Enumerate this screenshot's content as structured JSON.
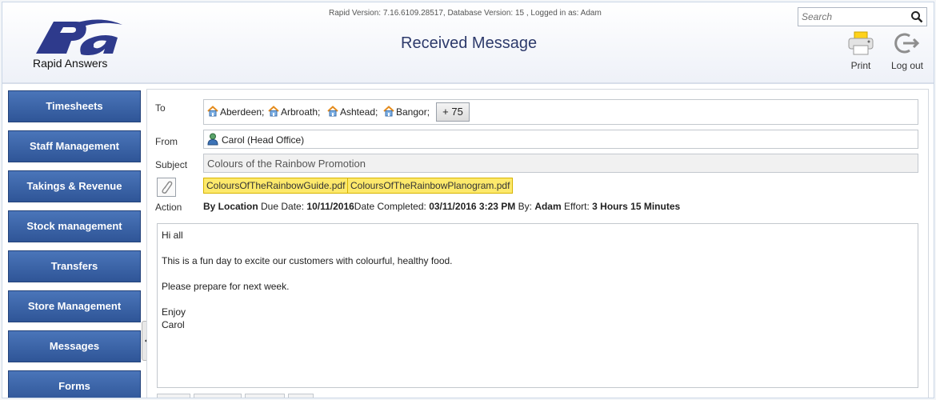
{
  "app": {
    "logo_text": "Rapid Answers",
    "version_info": "Rapid Version: 7.16.6109.28517, Database Version: 15 , Logged in as: Adam",
    "page_title": "Received Message",
    "search_placeholder": "Search",
    "print_label": "Print",
    "logout_label": "Log out"
  },
  "sidebar": {
    "items": [
      {
        "label": "Timesheets"
      },
      {
        "label": "Staff Management"
      },
      {
        "label": "Takings & Revenue"
      },
      {
        "label": "Stock management"
      },
      {
        "label": "Transfers"
      },
      {
        "label": "Store Management"
      },
      {
        "label": "Messages"
      },
      {
        "label": "Forms"
      }
    ]
  },
  "message": {
    "to_label": "To",
    "recipients": [
      "Aberdeen;",
      "Arbroath;",
      "Ashtead;",
      "Bangor;"
    ],
    "more_recipients": "+ 75",
    "from_label": "From",
    "from_value": "Carol (Head Office)",
    "subject_label": "Subject",
    "subject_value": "Colours of the Rainbow Promotion",
    "attachments": [
      "ColoursOfTheRainbowGuide.pdf",
      "ColoursOfTheRainbowPlanogram.pdf"
    ],
    "action_label": "Action",
    "action": {
      "by_location": "By Location",
      "due_label": "Due Date:",
      "due_value": "10/11/2016",
      "completed_label": "Date Completed:",
      "completed_value": "03/11/2016 3:23 PM",
      "by_label": "By:",
      "by_value": "Adam",
      "effort_label": "Effort:",
      "effort_value": "3 Hours 15 Minutes"
    },
    "body": {
      "greeting": "Hi all",
      "line1": "This is a fun day to excite our customers with colourful, healthy food.",
      "line2": "Please prepare for next week.",
      "closing": "Enjoy",
      "signature": "Carol"
    }
  },
  "colors": {
    "nav_button": "#2f5597",
    "title": "#2d3a6b",
    "attachment_bg": "#fde96b",
    "logo": "#2e3a8c"
  }
}
